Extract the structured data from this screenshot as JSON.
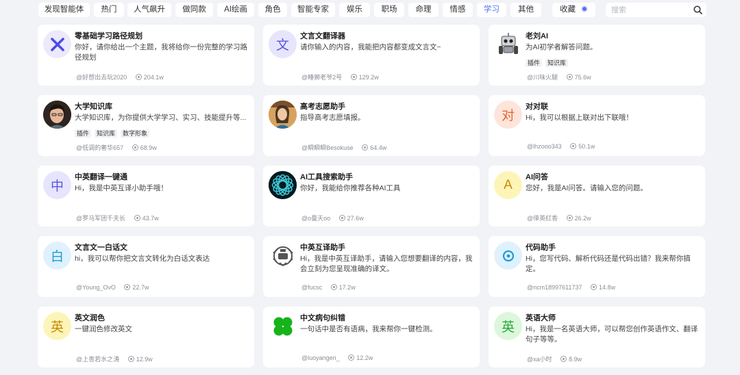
{
  "categories": [
    {
      "label": "发现智能体",
      "active": false
    },
    {
      "label": "热门",
      "active": false
    },
    {
      "label": "人气飙升",
      "active": false
    },
    {
      "label": "做同款",
      "active": false
    },
    {
      "label": "AI绘画",
      "active": false
    },
    {
      "label": "角色",
      "active": false
    },
    {
      "label": "智能专家",
      "active": false
    },
    {
      "label": "娱乐",
      "active": false
    },
    {
      "label": "职场",
      "active": false
    },
    {
      "label": "命理",
      "active": false
    },
    {
      "label": "情感",
      "active": false
    },
    {
      "label": "学习",
      "active": true
    },
    {
      "label": "其他",
      "active": false
    }
  ],
  "favorites_label": "收藏",
  "search": {
    "placeholder": "搜索",
    "value": ""
  },
  "colors": {
    "accent": "#4e6ef2",
    "page_bg": "#f2f3f7"
  },
  "cards": [
    {
      "title": "零基础学习路径规划",
      "desc": "你好，请你给出一个主题，我将给你一份完整的学习路径规划",
      "tags": [],
      "author": "@好想出去玩2020",
      "uses": "204.1w",
      "avatar": {
        "type": "x-icon",
        "text": "",
        "bg": "#ece9fb",
        "color": "#4d4ae8"
      }
    },
    {
      "title": "文言文翻译器",
      "desc": "请你输入的内容，我能把内容都变成文言文~",
      "tags": [],
      "author": "@睡狮老爷2号",
      "uses": "129.2w",
      "avatar": {
        "type": "letter",
        "text": "文",
        "bg": "#e6e5fb",
        "color": "#5b55e0"
      }
    },
    {
      "title": "老刘AI",
      "desc": "为AI初学者解答问题。",
      "tags": [
        "插件",
        "知识库"
      ],
      "author": "@川味火腿",
      "uses": "75.6w",
      "avatar": {
        "type": "robot-icon",
        "text": "",
        "bg": "#ffffff",
        "color": "#333"
      }
    },
    {
      "title": "大学知识库",
      "desc": "大学知识库，为你提供大学学习、实习、技能提升等...",
      "tags": [
        "插件",
        "知识库",
        "数字形象"
      ],
      "author": "@低调的奢华657",
      "uses": "68.9w",
      "avatar": {
        "type": "portrait-icon",
        "text": "",
        "bg": "#3a2a22",
        "color": "#e8b89a"
      }
    },
    {
      "title": "高考志愿助手",
      "desc": "指导高考志愿填报。",
      "tags": [],
      "author": "@瞬瞬瞬Besokuse",
      "uses": "64.4w",
      "avatar": {
        "type": "student-icon",
        "text": "",
        "bg": "#c98a4b",
        "color": "#3b2a1d"
      }
    },
    {
      "title": "对对联",
      "desc": "Hi，我可以根据上联对出下联哦！",
      "tags": [],
      "author": "@lhzooo343",
      "uses": "50.1w",
      "avatar": {
        "type": "letter",
        "text": "对",
        "bg": "#fde5dc",
        "color": "#e8652f"
      }
    },
    {
      "title": "中英翻译一键通",
      "desc": "Hi，我是中英互译小助手哦！",
      "tags": [],
      "author": "@罗马军团千夫长",
      "uses": "43.7w",
      "avatar": {
        "type": "letter",
        "text": "中",
        "bg": "#e6e5fb",
        "color": "#5b55e0"
      }
    },
    {
      "title": "AI工具搜索助手",
      "desc": "你好，我能给你推荐各种AI工具",
      "tags": [],
      "author": "@o曼天oo",
      "uses": "27.6w",
      "avatar": {
        "type": "spiral-icon",
        "text": "",
        "bg": "#0d2f3a",
        "color": "#3fc6d4"
      }
    },
    {
      "title": "AI问答",
      "desc": "您好，我是AI问答。请输入您的问题。",
      "tags": [],
      "author": "@倖英红香",
      "uses": "26.2w",
      "avatar": {
        "type": "letter",
        "text": "A",
        "bg": "#fdf4b8",
        "color": "#c58a06"
      }
    },
    {
      "title": "文言文一白话文",
      "desc": "hi，我可以帮你把文言文转化为白话文表达",
      "tags": [],
      "author": "@Young_OvO",
      "uses": "22.7w",
      "avatar": {
        "type": "letter",
        "text": "白",
        "bg": "#dff1fc",
        "color": "#1c9ad6"
      }
    },
    {
      "title": "中英互译助手",
      "desc": "Hi，我是中英互译助手，请输入您想要翻译的内容，我会立刻为您呈现准确的译文。",
      "tags": [],
      "author": "@fucsc",
      "uses": "17.2w",
      "avatar": {
        "type": "badge-icon",
        "text": "",
        "bg": "#ffffff",
        "color": "#555"
      }
    },
    {
      "title": "代码助手",
      "desc": "Hi，您写代码、解析代码还是代码出错？我来帮你搞定。",
      "tags": [],
      "author": "@ncm18997611737",
      "uses": "14.8w",
      "avatar": {
        "type": "target-icon",
        "text": "",
        "bg": "#dff1fc",
        "color": "#1c9ad6"
      }
    },
    {
      "title": "英文润色",
      "desc": "一键润色修改英文",
      "tags": [],
      "author": "@上善若水之涛",
      "uses": "12.9w",
      "avatar": {
        "type": "letter",
        "text": "英",
        "bg": "#fdf4b8",
        "color": "#c58a06"
      }
    },
    {
      "title": "中文病句纠错",
      "desc": "一句话中是否有语病，我来帮你一键检测。",
      "tags": [],
      "author": "@luoyangen_",
      "uses": "12.2w",
      "avatar": {
        "type": "clover-icon",
        "text": "",
        "bg": "#ffffff",
        "color": "#16b31a"
      }
    },
    {
      "title": "英语大师",
      "desc": "Hi，我是一名英语大师，可以帮您创作英语作文、翻译句子等等。",
      "tags": [],
      "author": "@xa小时",
      "uses": "8.9w",
      "avatar": {
        "type": "letter",
        "text": "英",
        "bg": "#dcf7dc",
        "color": "#27a838"
      }
    }
  ]
}
